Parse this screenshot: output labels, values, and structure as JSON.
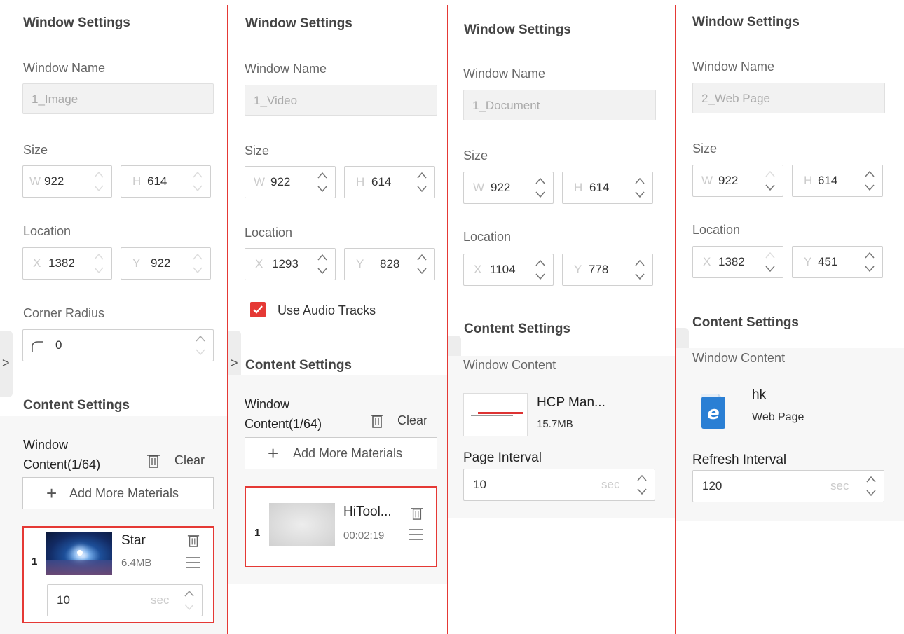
{
  "panels": [
    {
      "section_title": "Window Settings",
      "window_name_label": "Window Name",
      "window_name_value": "1_Image",
      "size_label": "Size",
      "size_w": {
        "prefix": "W",
        "value": "922"
      },
      "size_h": {
        "prefix": "H",
        "value": "614"
      },
      "location_label": "Location",
      "loc_x": {
        "prefix": "X",
        "value": "1382"
      },
      "loc_y": {
        "prefix": "Y",
        "value": "922"
      },
      "corner_radius_label": "Corner Radius",
      "corner_radius_value": "0",
      "content_settings_title": "Content Settings",
      "window_content_line1": "Window",
      "window_content_line2": "Content(1/64)",
      "clear_label": "Clear",
      "add_label": "Add More Materials",
      "item": {
        "index": "1",
        "name": "Star",
        "size": "6.4MB",
        "duration": "10",
        "unit": "sec"
      }
    },
    {
      "section_title": "Window Settings",
      "window_name_label": "Window Name",
      "window_name_value": "1_Video",
      "size_label": "Size",
      "size_w": {
        "prefix": "W",
        "value": "922"
      },
      "size_h": {
        "prefix": "H",
        "value": "614"
      },
      "location_label": "Location",
      "loc_x": {
        "prefix": "X",
        "value": "1293"
      },
      "loc_y": {
        "prefix": "Y",
        "value": "828"
      },
      "audio_label": "Use Audio Tracks",
      "audio_checked": true,
      "content_settings_title": "Content Settings",
      "window_content_line1": "Window",
      "window_content_line2": "Content(1/64)",
      "clear_label": "Clear",
      "add_label": "Add More Materials",
      "item": {
        "index": "1",
        "name": "HiTool...",
        "duration": "00:02:19"
      }
    },
    {
      "section_title": "Window Settings",
      "window_name_label": "Window Name",
      "window_name_value": "1_Document",
      "size_label": "Size",
      "size_w": {
        "prefix": "W",
        "value": "922"
      },
      "size_h": {
        "prefix": "H",
        "value": "614"
      },
      "location_label": "Location",
      "loc_x": {
        "prefix": "X",
        "value": "1104"
      },
      "loc_y": {
        "prefix": "Y",
        "value": "778"
      },
      "content_settings_title": "Content Settings",
      "window_content_label": "Window Content",
      "item": {
        "name": "HCP Man...",
        "size": "15.7MB"
      },
      "interval_label": "Page Interval",
      "interval_value": "10",
      "unit": "sec"
    },
    {
      "section_title": "Window Settings",
      "window_name_label": "Window Name",
      "window_name_value": "2_Web Page",
      "size_label": "Size",
      "size_w": {
        "prefix": "W",
        "value": "922"
      },
      "size_h": {
        "prefix": "H",
        "value": "614"
      },
      "location_label": "Location",
      "loc_x": {
        "prefix": "X",
        "value": "1382"
      },
      "loc_y": {
        "prefix": "Y",
        "value": "451"
      },
      "content_settings_title": "Content Settings",
      "window_content_label": "Window Content",
      "item": {
        "name": "hk",
        "type": "Web Page"
      },
      "interval_label": "Refresh Interval",
      "interval_value": "120",
      "unit": "sec"
    }
  ],
  "handle_glyph": ">",
  "colors": {
    "accent": "#e53935",
    "panel_bg": "#f7f7f7",
    "ie_blue": "#2a7fd4"
  }
}
